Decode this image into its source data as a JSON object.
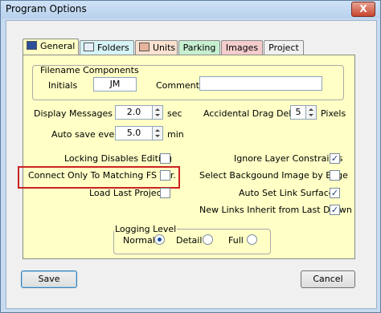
{
  "window": {
    "title": "Program Options",
    "close_label": "X"
  },
  "tabs": [
    {
      "label": "General",
      "color": "#ffffc6",
      "icon": "general-icon"
    },
    {
      "label": "Folders",
      "color": "#d6f3f7",
      "icon": "folders-icon"
    },
    {
      "label": "Units",
      "color": "#fbe1cf",
      "icon": "units-icon"
    },
    {
      "label": "Parking",
      "color": "#c6efcf",
      "icon": ""
    },
    {
      "label": "Images",
      "color": "#f4cccc",
      "icon": ""
    },
    {
      "label": "Project",
      "color": "#f0f0f0",
      "icon": ""
    }
  ],
  "filename": {
    "heading": "Filename Components",
    "initials_label": "Initials",
    "initials_value": "JM",
    "comment_label": "Comment",
    "comment_value": ""
  },
  "display_messages": {
    "label": "Display Messages for",
    "value": "2.0",
    "unit": "sec"
  },
  "autosave": {
    "label": "Auto save every",
    "value": "5.0",
    "unit": "min"
  },
  "drag_delay": {
    "label": "Accidental Drag Delay",
    "value": "5",
    "unit": "Pixels"
  },
  "left_options": [
    {
      "label": "Locking Disables Editing",
      "checked": false
    },
    {
      "label": "Connect Only To Matching FS Ver.",
      "checked": false
    },
    {
      "label": "Load Last Project",
      "checked": false
    }
  ],
  "right_options": [
    {
      "label": "Ignore Layer Constraints",
      "checked": true
    },
    {
      "label": "Select Backgound Image by Edge",
      "checked": false
    },
    {
      "label": "Auto Set Link Surfaces",
      "checked": true
    },
    {
      "label": "New Links Inherit from Last Drawn",
      "checked": true
    }
  ],
  "logging": {
    "heading": "Logging Level",
    "options": [
      {
        "label": "Normal",
        "selected": true
      },
      {
        "label": "Detail",
        "selected": false
      },
      {
        "label": "Full",
        "selected": false
      }
    ]
  },
  "buttons": {
    "save": "Save",
    "cancel": "Cancel"
  },
  "check_mark": "✓",
  "highlight_color": "#cc2222"
}
